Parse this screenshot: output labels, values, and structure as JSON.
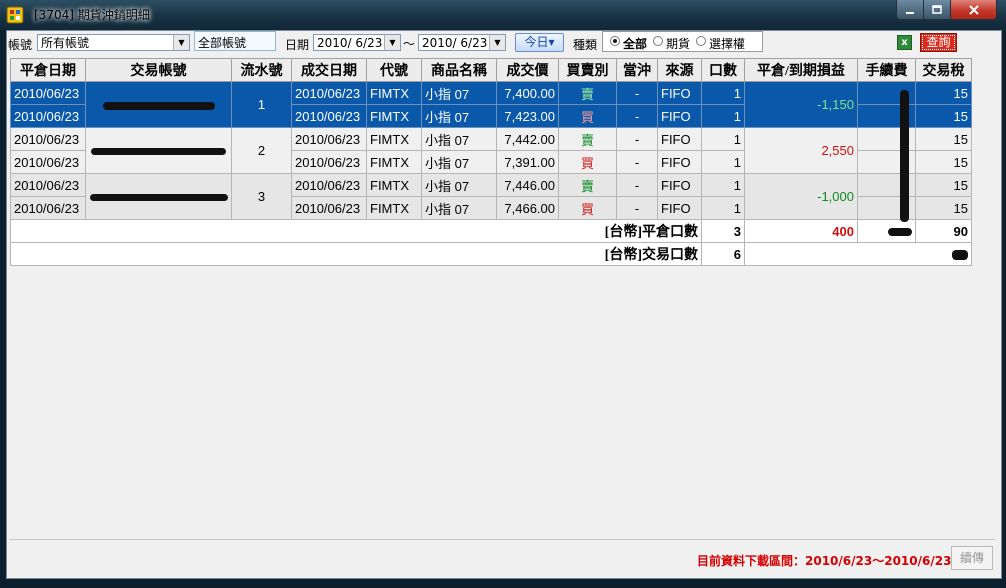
{
  "window": {
    "title": "[3704] 期貨沖銷明細"
  },
  "toolbar": {
    "account_label": "帳號",
    "account_value": "所有帳號",
    "all_account_text": "全部帳號",
    "date_label": "日期",
    "date_from": "2010/ 6/23",
    "date_sep": "～",
    "date_to": "2010/ 6/23",
    "today_label": "今日▾",
    "type_label": "種類",
    "type_options": [
      "全部",
      "期貨",
      "選擇權"
    ],
    "type_selected": "全部",
    "query_label": "查詢",
    "excel_icon": "excel-icon"
  },
  "table": {
    "headers": [
      "平倉日期",
      "交易帳號",
      "流水號",
      "成交日期",
      "代號",
      "商品名稱",
      "成交價",
      "買賣別",
      "當沖",
      "來源",
      "口數",
      "平倉/到期損益",
      "手續費",
      "交易稅"
    ],
    "groups": [
      {
        "serial": "1",
        "pnl": "-1,150",
        "rows": [
          {
            "close_date": "2010/06/23",
            "trade_date": "2010/06/23",
            "code": "FIMTX",
            "name": "小指 07",
            "price": "7,400.00",
            "side": "賣",
            "daytrade": "-",
            "source": "FIFO",
            "qty": "1",
            "tax": "15"
          },
          {
            "close_date": "2010/06/23",
            "trade_date": "2010/06/23",
            "code": "FIMTX",
            "name": "小指 07",
            "price": "7,423.00",
            "side": "買",
            "daytrade": "-",
            "source": "FIFO",
            "qty": "1",
            "tax": "15"
          }
        ]
      },
      {
        "serial": "2",
        "pnl": "2,550",
        "rows": [
          {
            "close_date": "2010/06/23",
            "trade_date": "2010/06/23",
            "code": "FIMTX",
            "name": "小指 07",
            "price": "7,442.00",
            "side": "賣",
            "daytrade": "-",
            "source": "FIFO",
            "qty": "1",
            "tax": "15"
          },
          {
            "close_date": "2010/06/23",
            "trade_date": "2010/06/23",
            "code": "FIMTX",
            "name": "小指 07",
            "price": "7,391.00",
            "side": "買",
            "daytrade": "-",
            "source": "FIFO",
            "qty": "1",
            "tax": "15"
          }
        ]
      },
      {
        "serial": "3",
        "pnl": "-1,000",
        "rows": [
          {
            "close_date": "2010/06/23",
            "trade_date": "2010/06/23",
            "code": "FIMTX",
            "name": "小指 07",
            "price": "7,446.00",
            "side": "賣",
            "daytrade": "-",
            "source": "FIFO",
            "qty": "1",
            "tax": "15"
          },
          {
            "close_date": "2010/06/23",
            "trade_date": "2010/06/23",
            "code": "FIMTX",
            "name": "小指 07",
            "price": "7,466.00",
            "side": "買",
            "daytrade": "-",
            "source": "FIFO",
            "qty": "1",
            "tax": "15"
          }
        ]
      }
    ],
    "summary": {
      "close_label": "[台幣]平倉口數",
      "close_qty": "3",
      "close_pnl": "400",
      "close_tax": "90",
      "trade_label": "[台幣]交易口數",
      "trade_qty": "6"
    }
  },
  "footer": {
    "range_note": "目前資料下載區間：2010/6/23～2010/6/23",
    "continue_label": "續傳"
  }
}
